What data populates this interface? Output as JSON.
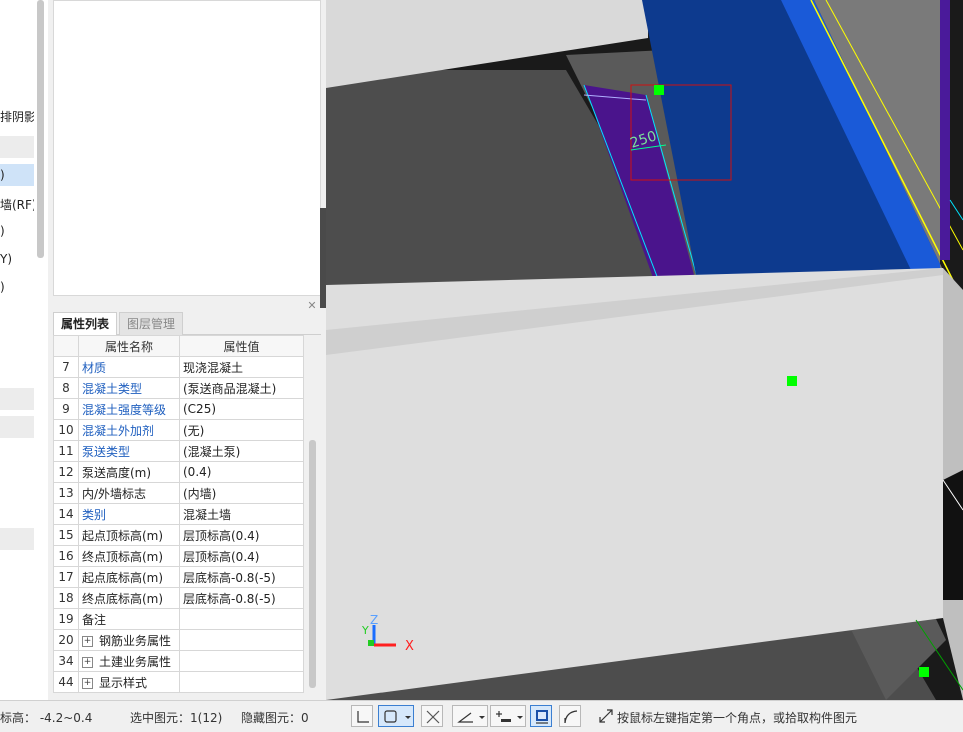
{
  "left_panel": {
    "items": [
      "排阴影",
      ")",
      "墙(RF)",
      ")",
      "Y)",
      ")"
    ]
  },
  "properties": {
    "tabs": [
      "属性列表",
      "图层管理"
    ],
    "headers": [
      "属性名称",
      "属性值"
    ],
    "rows": [
      {
        "no": "7",
        "name": "材质",
        "value": "现浇混凝土",
        "link": true
      },
      {
        "no": "8",
        "name": "混凝土类型",
        "value": "(泵送商品混凝土)",
        "link": true
      },
      {
        "no": "9",
        "name": "混凝土强度等级",
        "value": "(C25)",
        "link": true
      },
      {
        "no": "10",
        "name": "混凝土外加剂",
        "value": "(无)",
        "link": true
      },
      {
        "no": "11",
        "name": "泵送类型",
        "value": "(混凝土泵)",
        "link": true
      },
      {
        "no": "12",
        "name": "泵送高度(m)",
        "value": "(0.4)",
        "link": false
      },
      {
        "no": "13",
        "name": "内/外墙标志",
        "value": "(内墙)",
        "link": false
      },
      {
        "no": "14",
        "name": "类别",
        "value": "混凝土墙",
        "link": true
      },
      {
        "no": "15",
        "name": "起点顶标高(m)",
        "value": "层顶标高(0.4)",
        "link": false
      },
      {
        "no": "16",
        "name": "终点顶标高(m)",
        "value": "层顶标高(0.4)",
        "link": false
      },
      {
        "no": "17",
        "name": "起点底标高(m)",
        "value": "层底标高-0.8(-5)",
        "link": false
      },
      {
        "no": "18",
        "name": "终点底标高(m)",
        "value": "层底标高-0.8(-5)",
        "link": false
      },
      {
        "no": "19",
        "name": "备注",
        "value": "",
        "link": false
      },
      {
        "no": "20",
        "name": "钢筋业务属性",
        "value": "",
        "link": false,
        "expandable": true
      },
      {
        "no": "34",
        "name": "土建业务属性",
        "value": "",
        "link": false,
        "expandable": true
      },
      {
        "no": "44",
        "name": "显示样式",
        "value": "",
        "link": false,
        "expandable": true
      }
    ]
  },
  "viewport": {
    "dimension_label": "250",
    "axis_x": "X",
    "axis_y": "Y",
    "axis_z": "Z",
    "colors": {
      "wall_gray": "#dcdcdc",
      "wall_blue": "#0a3a8c",
      "purple": "#4a148c",
      "selection": "#00ff00"
    }
  },
  "status": {
    "elevation": "标高： -4.2~0.4",
    "selected": "选中图元：1(12)",
    "hidden": "隐藏图元：0",
    "hint": "按鼠标左键指定第一个角点，或拾取构件图元"
  }
}
